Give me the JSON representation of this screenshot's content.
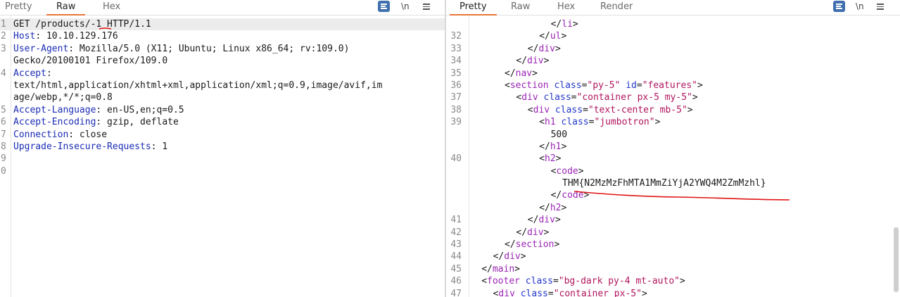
{
  "request_pane": {
    "tabs": [
      "Pretty",
      "Raw",
      "Hex"
    ],
    "active_tab": "Raw",
    "wrap_toggle_icon": "wrap-icon",
    "newline_toggle": "\\n",
    "menu_icon": "hamburger-menu-icon",
    "lines": [
      {
        "num": "1",
        "segments": [
          {
            "t": "GET /products/-1 HTTP/1.1",
            "c": "plain"
          }
        ]
      },
      {
        "num": "2",
        "segments": [
          {
            "t": "Host",
            "c": "k"
          },
          {
            "t": ": 10.10.129.176",
            "c": "plain"
          }
        ]
      },
      {
        "num": "3",
        "segments": [
          {
            "t": "User-Agent",
            "c": "k"
          },
          {
            "t": ": Mozilla/5.0 (X11; Ubuntu; Linux x86_64; rv:109.0)",
            "c": "plain"
          }
        ]
      },
      {
        "num": "",
        "segments": [
          {
            "t": "Gecko/20100101 Firefox/109.0",
            "c": "plain"
          }
        ]
      },
      {
        "num": "4",
        "segments": [
          {
            "t": "Accept",
            "c": "k"
          },
          {
            "t": ":",
            "c": "plain"
          }
        ]
      },
      {
        "num": "",
        "segments": [
          {
            "t": "text/html,application/xhtml+xml,application/xml;q=0.9,image/avif,im",
            "c": "plain"
          }
        ]
      },
      {
        "num": "",
        "segments": [
          {
            "t": "age/webp,*/*;q=0.8",
            "c": "plain"
          }
        ]
      },
      {
        "num": "5",
        "segments": [
          {
            "t": "Accept-Language",
            "c": "k"
          },
          {
            "t": ": en-US,en;q=0.5",
            "c": "plain"
          }
        ]
      },
      {
        "num": "6",
        "segments": [
          {
            "t": "Accept-Encoding",
            "c": "k"
          },
          {
            "t": ": gzip, deflate",
            "c": "plain"
          }
        ]
      },
      {
        "num": "7",
        "segments": [
          {
            "t": "Connection",
            "c": "k"
          },
          {
            "t": ": close",
            "c": "plain"
          }
        ]
      },
      {
        "num": "8",
        "segments": [
          {
            "t": "Upgrade-Insecure-Requests",
            "c": "k"
          },
          {
            "t": ": 1",
            "c": "plain"
          }
        ]
      },
      {
        "num": "9",
        "segments": []
      },
      {
        "num": "0",
        "segments": []
      }
    ]
  },
  "response_pane": {
    "tabs": [
      "Pretty",
      "Raw",
      "Hex",
      "Render"
    ],
    "active_tab": "Pretty",
    "wrap_toggle_icon": "wrap-icon",
    "newline_toggle": "\\n",
    "menu_icon": "hamburger-menu-icon",
    "lines": [
      {
        "num": "",
        "indent": 13,
        "segments": [
          {
            "t": "</",
            "c": "plain"
          },
          {
            "t": "li",
            "c": "tag"
          },
          {
            "t": ">",
            "c": "plain"
          }
        ]
      },
      {
        "num": "32",
        "indent": 11,
        "segments": [
          {
            "t": "</",
            "c": "plain"
          },
          {
            "t": "ul",
            "c": "tag"
          },
          {
            "t": ">",
            "c": "plain"
          }
        ]
      },
      {
        "num": "33",
        "indent": 9,
        "segments": [
          {
            "t": "</",
            "c": "plain"
          },
          {
            "t": "div",
            "c": "tag"
          },
          {
            "t": ">",
            "c": "plain"
          }
        ]
      },
      {
        "num": "34",
        "indent": 7,
        "segments": [
          {
            "t": "</",
            "c": "plain"
          },
          {
            "t": "div",
            "c": "tag"
          },
          {
            "t": ">",
            "c": "plain"
          }
        ]
      },
      {
        "num": "35",
        "indent": 5,
        "segments": [
          {
            "t": "</",
            "c": "plain"
          },
          {
            "t": "nav",
            "c": "tag"
          },
          {
            "t": ">",
            "c": "plain"
          }
        ]
      },
      {
        "num": "36",
        "indent": 5,
        "segments": [
          {
            "t": "<",
            "c": "plain"
          },
          {
            "t": "section",
            "c": "tag"
          },
          {
            "t": " class",
            "c": "attr"
          },
          {
            "t": "=",
            "c": "plain"
          },
          {
            "t": "\"py-5\"",
            "c": "val"
          },
          {
            "t": " id",
            "c": "attr"
          },
          {
            "t": "=",
            "c": "plain"
          },
          {
            "t": "\"features\"",
            "c": "val"
          },
          {
            "t": ">",
            "c": "plain"
          }
        ]
      },
      {
        "num": "37",
        "indent": 7,
        "segments": [
          {
            "t": "<",
            "c": "plain"
          },
          {
            "t": "div",
            "c": "tag"
          },
          {
            "t": " class",
            "c": "attr"
          },
          {
            "t": "=",
            "c": "plain"
          },
          {
            "t": "\"container px-5 my-5\"",
            "c": "val"
          },
          {
            "t": ">",
            "c": "plain"
          }
        ]
      },
      {
        "num": "38",
        "indent": 9,
        "segments": [
          {
            "t": "<",
            "c": "plain"
          },
          {
            "t": "div",
            "c": "tag"
          },
          {
            "t": " class",
            "c": "attr"
          },
          {
            "t": "=",
            "c": "plain"
          },
          {
            "t": "\"text-center mb-5\"",
            "c": "val"
          },
          {
            "t": ">",
            "c": "plain"
          }
        ]
      },
      {
        "num": "39",
        "indent": 11,
        "segments": [
          {
            "t": "<",
            "c": "plain"
          },
          {
            "t": "h1",
            "c": "tag"
          },
          {
            "t": " class",
            "c": "attr"
          },
          {
            "t": "=",
            "c": "plain"
          },
          {
            "t": "\"jumbotron\"",
            "c": "val"
          },
          {
            "t": ">",
            "c": "plain"
          }
        ]
      },
      {
        "num": "",
        "indent": 13,
        "segments": [
          {
            "t": "500",
            "c": "plain"
          }
        ]
      },
      {
        "num": "",
        "indent": 11,
        "segments": [
          {
            "t": "</",
            "c": "plain"
          },
          {
            "t": "h1",
            "c": "tag"
          },
          {
            "t": ">",
            "c": "plain"
          }
        ]
      },
      {
        "num": "40",
        "indent": 11,
        "segments": [
          {
            "t": "<",
            "c": "plain"
          },
          {
            "t": "h2",
            "c": "tag"
          },
          {
            "t": ">",
            "c": "plain"
          }
        ]
      },
      {
        "num": "",
        "indent": 13,
        "segments": [
          {
            "t": "<",
            "c": "plain"
          },
          {
            "t": "code",
            "c": "tag"
          },
          {
            "t": ">",
            "c": "plain"
          }
        ]
      },
      {
        "num": "",
        "indent": 15,
        "segments": [
          {
            "t": "THM{N2MzMzFhMTA1MmZiYjA2YWQ4M2ZmMzhl}",
            "c": "plain"
          }
        ]
      },
      {
        "num": "",
        "indent": 13,
        "segments": [
          {
            "t": "</",
            "c": "plain"
          },
          {
            "t": "code",
            "c": "tag"
          },
          {
            "t": ">",
            "c": "plain"
          }
        ]
      },
      {
        "num": "",
        "indent": 11,
        "segments": [
          {
            "t": "</",
            "c": "plain"
          },
          {
            "t": "h2",
            "c": "tag"
          },
          {
            "t": ">",
            "c": "plain"
          }
        ]
      },
      {
        "num": "41",
        "indent": 9,
        "segments": [
          {
            "t": "</",
            "c": "plain"
          },
          {
            "t": "div",
            "c": "tag"
          },
          {
            "t": ">",
            "c": "plain"
          }
        ]
      },
      {
        "num": "42",
        "indent": 7,
        "segments": [
          {
            "t": "</",
            "c": "plain"
          },
          {
            "t": "div",
            "c": "tag"
          },
          {
            "t": ">",
            "c": "plain"
          }
        ]
      },
      {
        "num": "43",
        "indent": 5,
        "segments": [
          {
            "t": "</",
            "c": "plain"
          },
          {
            "t": "section",
            "c": "tag"
          },
          {
            "t": ">",
            "c": "plain"
          }
        ]
      },
      {
        "num": "44",
        "indent": 3,
        "segments": [
          {
            "t": "</",
            "c": "plain"
          },
          {
            "t": "div",
            "c": "tag"
          },
          {
            "t": ">",
            "c": "plain"
          }
        ]
      },
      {
        "num": "45",
        "indent": 1,
        "segments": [
          {
            "t": "</",
            "c": "plain"
          },
          {
            "t": "main",
            "c": "tag"
          },
          {
            "t": ">",
            "c": "plain"
          }
        ]
      },
      {
        "num": "46",
        "indent": 1,
        "segments": [
          {
            "t": "<",
            "c": "plain"
          },
          {
            "t": "footer",
            "c": "tag"
          },
          {
            "t": " class",
            "c": "attr"
          },
          {
            "t": "=",
            "c": "plain"
          },
          {
            "t": "\"bg-dark py-4 mt-auto\"",
            "c": "val"
          },
          {
            "t": ">",
            "c": "plain"
          }
        ]
      },
      {
        "num": "47",
        "indent": 3,
        "segments": [
          {
            "t": "<",
            "c": "plain"
          },
          {
            "t": "div",
            "c": "tag"
          },
          {
            "t": " class",
            "c": "attr"
          },
          {
            "t": "=",
            "c": "plain"
          },
          {
            "t": "\"container px-5\"",
            "c": "val"
          },
          {
            "t": ">",
            "c": "plain"
          }
        ]
      }
    ]
  },
  "colors": {
    "active_tab_underline": "#e8763a",
    "wrap_button": "#3f6fae",
    "annotation_red": "#e01414",
    "current_line_bg": "#ececec"
  }
}
